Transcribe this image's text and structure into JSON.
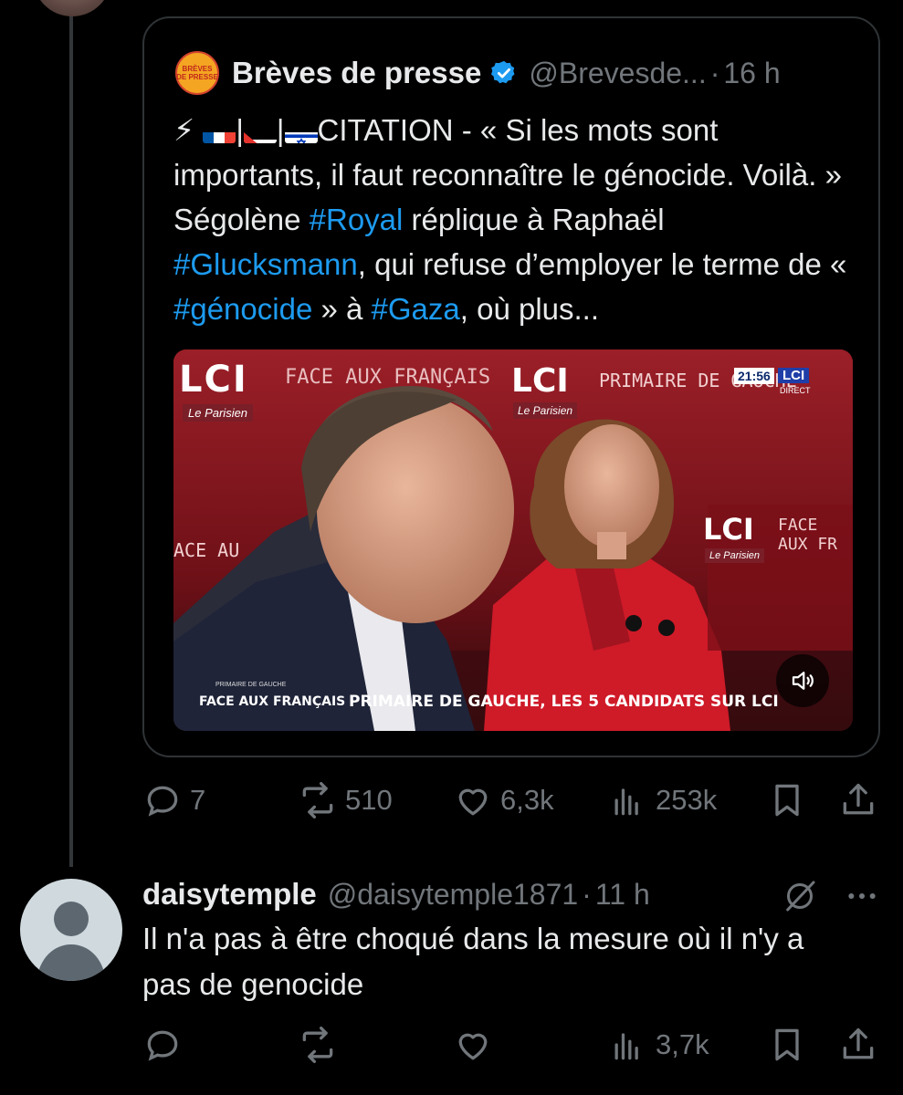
{
  "quoted_post": {
    "author_name": "Brèves de presse",
    "handle": "@Brevesde...",
    "separator": "·",
    "time": "16 h",
    "logo_line1": "BRÈVES",
    "logo_line2": "DE PRESSE",
    "text_parts": {
      "p1": "⚡",
      "p2": "|",
      "p3": "|",
      "p4": "CITATION - « Si les mots sont importants, il faut reconnaître le génocide. Voilà. » Ségolène ",
      "h1": "#Royal",
      "p5": " réplique à Raphaël ",
      "h2": "#Glucksmann",
      "p6": ", qui refuse d’employer le terme de « ",
      "h3": "#génocide",
      "p7": " » à ",
      "h4": "#Gaza",
      "p8": ", où plus..."
    },
    "video": {
      "lci_1": "LCI",
      "parisien_1": "Le Parisien",
      "face_top": "FACE AUX FRANÇAIS",
      "lci_2": "LCI",
      "parisien_2": "Le Parisien",
      "primaire_top": "PRIMAIRE DE GAUCHE",
      "time": "21:56",
      "lci_badge": "LCI",
      "direct": "DIRECT",
      "face_left": "ACE AU",
      "lci_3": "LCI",
      "parisien_3": "Le Parisien",
      "face_right": "FACE AUX FR",
      "lower_small": "PRIMAIRE DE GAUCHE",
      "lower_left": "FACE AUX FRANÇAIS",
      "lower_right": "PRIMAIRE DE GAUCHE, LES 5 CANDIDATS SUR LCI"
    }
  },
  "main_actions": {
    "replies": "7",
    "reposts": "510",
    "likes": "6,3k",
    "views": "253k"
  },
  "reply": {
    "author_name": "daisytemple",
    "handle": "@daisytemple1871",
    "separator": "·",
    "time": "11 h",
    "text": "Il n'a pas à être choqué dans la mesure où il n'y a pas de genocide",
    "views": "3,7k"
  },
  "colors": {
    "background": "#000000",
    "accent": "#1d9bf0",
    "muted": "#71767b",
    "border": "#2f3336",
    "text": "#e7e9ea"
  }
}
